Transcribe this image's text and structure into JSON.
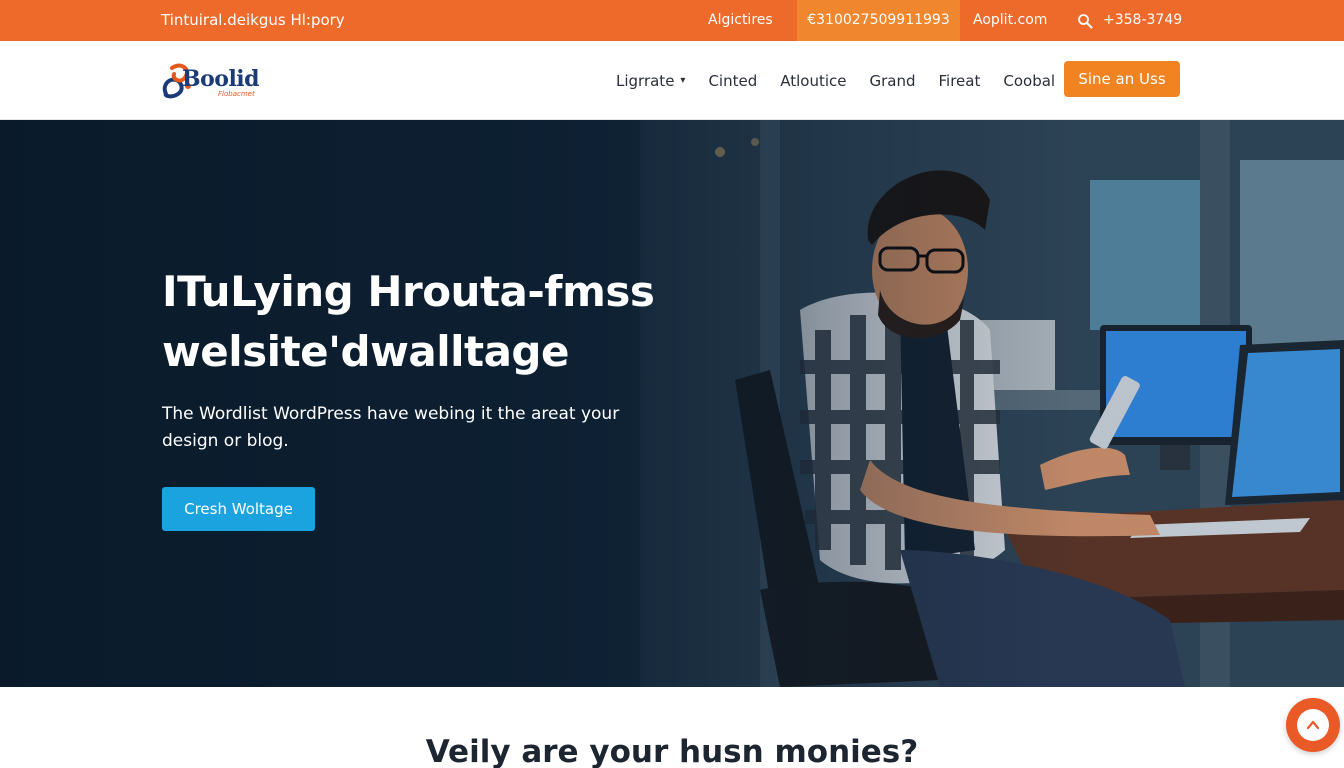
{
  "topbar": {
    "tagline": "Tintuiral.deikgus Hl:pory",
    "address": "Algictires",
    "phone_box": "€310027509911993",
    "email": "Aoplit.com",
    "phone": "+358-3749",
    "search_icon": "search-icon",
    "colors": {
      "background": "#ee6a2a",
      "phone_box": "#f0862e"
    }
  },
  "header": {
    "logo_text": "Boolid",
    "logo_sub": "Flobacmet",
    "nav": [
      {
        "label": "Ligrrate",
        "has_dropdown": true
      },
      {
        "label": "Cinted"
      },
      {
        "label": "Atloutice"
      },
      {
        "label": "Grand"
      },
      {
        "label": "Fireat"
      },
      {
        "label": "Coobal"
      }
    ],
    "cta_label": "Sine an Uss",
    "cta_color": "#f28321"
  },
  "hero": {
    "title_line1": "ITuLying Hrouta-fmss",
    "title_line2": "welsite'dwalltage",
    "description": "The Wordlist WordPress have webing it the areat your design or blog.",
    "button_label": "Cresh Woltage",
    "button_color": "#1ba3e0"
  },
  "section": {
    "title": "Veily are your husn monies?"
  },
  "scroll_top": {
    "icon": "chevron-up-icon",
    "color": "#ea5a26"
  }
}
